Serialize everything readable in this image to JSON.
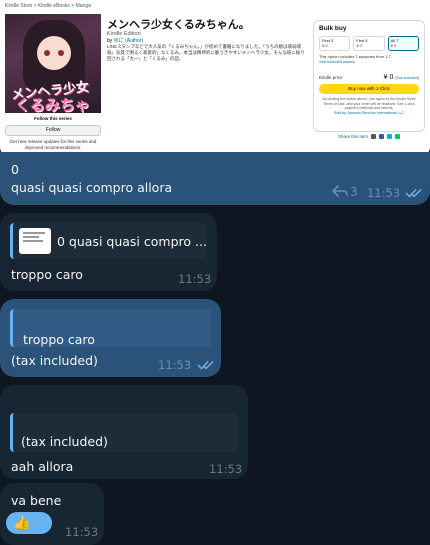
{
  "kindle": {
    "breadcrumb": "Kindle Store > Kindle eBooks > Manga",
    "title": "メンヘラ少女くるみちゃん。",
    "edition": "Kindle Edition",
    "author_prefix": "by",
    "author_name": "ゆに",
    "author_role": "(Author)",
    "description": "LINEスタンプなどで大人気の「くるみちゃん。」が初めて書籍になりました。「うちの娘は病弱病弱」気質で明るく家庭的」なくるみ。本当は精神的に脆うきやすいメンヘラ少女。そんな彼に振り回される「大一」と「くるみ」の話。",
    "cover_title_1": "メンヘラ少女",
    "cover_title_2": "くるみちゃん。",
    "follow_label": "Follow this series",
    "follow_button": "Follow",
    "follow_note": "Get new release updates for this series and improved recommendations.",
    "bulk_title": "Bulk buy",
    "options": [
      {
        "label": "First 3",
        "price": "¥ 0"
      },
      {
        "label": "First 5",
        "price": "¥ 0"
      },
      {
        "label": "All 7",
        "price": "¥ 0"
      }
    ],
    "bulk_info": "This option includes 7 episodes from 1-7.",
    "bulk_link": "See included issues",
    "price_label": "Kindle price",
    "price_value": "¥ 0",
    "price_tax": "(Tax included)",
    "buy_button": "Buy now with 1-Click",
    "terms": "By clicking the button above, you agree to the Kindle Store Terms of Use, and your order will be finalised. See 1-click payment methods and returns.",
    "sold_by": "Sold by: Amazon Services International LLC",
    "share": "Share this item"
  },
  "messages": [
    {
      "line1": "0",
      "line2": "quasi quasi compro allora",
      "replies": "3",
      "time": "11:53"
    },
    {
      "quote": "0 quasi quasi compro ...",
      "text": "troppo caro",
      "time": "11:53"
    },
    {
      "quote": "troppo caro",
      "text": "(tax included)",
      "time": "11:53"
    },
    {
      "quote": "(tax included)",
      "text": "aah allora",
      "time": "11:53"
    },
    {
      "text": "va bene",
      "reaction": "👍",
      "time": "11:53"
    }
  ],
  "colors": {
    "background": "#0e1621",
    "outgoing": "#2b5278",
    "incoming": "#182533",
    "accent": "#6ab2f2"
  }
}
